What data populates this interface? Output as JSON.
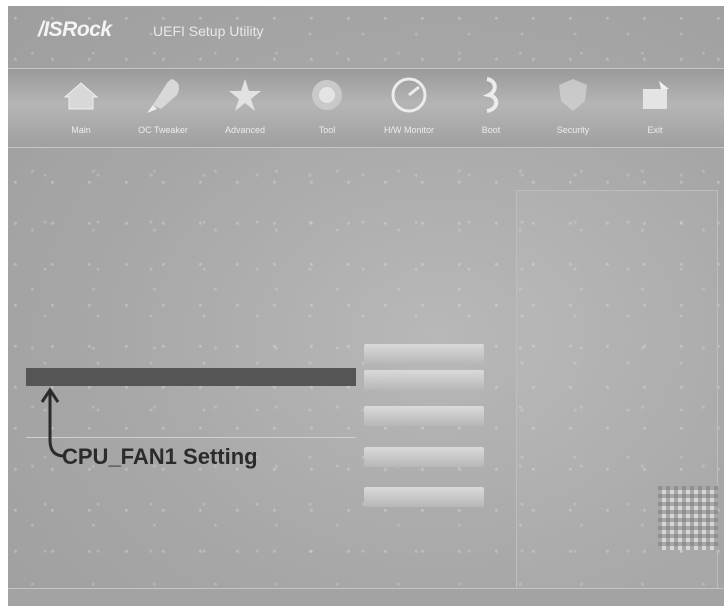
{
  "header": {
    "brand": "/ISRock",
    "utility_title": "UEFI Setup Utility"
  },
  "tabs": [
    {
      "label": "Main",
      "icon": "house-icon"
    },
    {
      "label": "OC Tweaker",
      "icon": "rocket-icon"
    },
    {
      "label": "Advanced",
      "icon": "star-icon"
    },
    {
      "label": "Tool",
      "icon": "tool-icon"
    },
    {
      "label": "H/W Monitor",
      "icon": "gauge-icon"
    },
    {
      "label": "Boot",
      "icon": "power-icon"
    },
    {
      "label": "Security",
      "icon": "shield-icon"
    },
    {
      "label": "Exit",
      "icon": "exit-icon"
    }
  ],
  "annotation": {
    "label": "CPU_FAN1 Setting"
  },
  "colors": {
    "highlight_row": "#555555",
    "annotation_text": "#2b2b2b",
    "screen_bg": "#a9a9a9"
  }
}
